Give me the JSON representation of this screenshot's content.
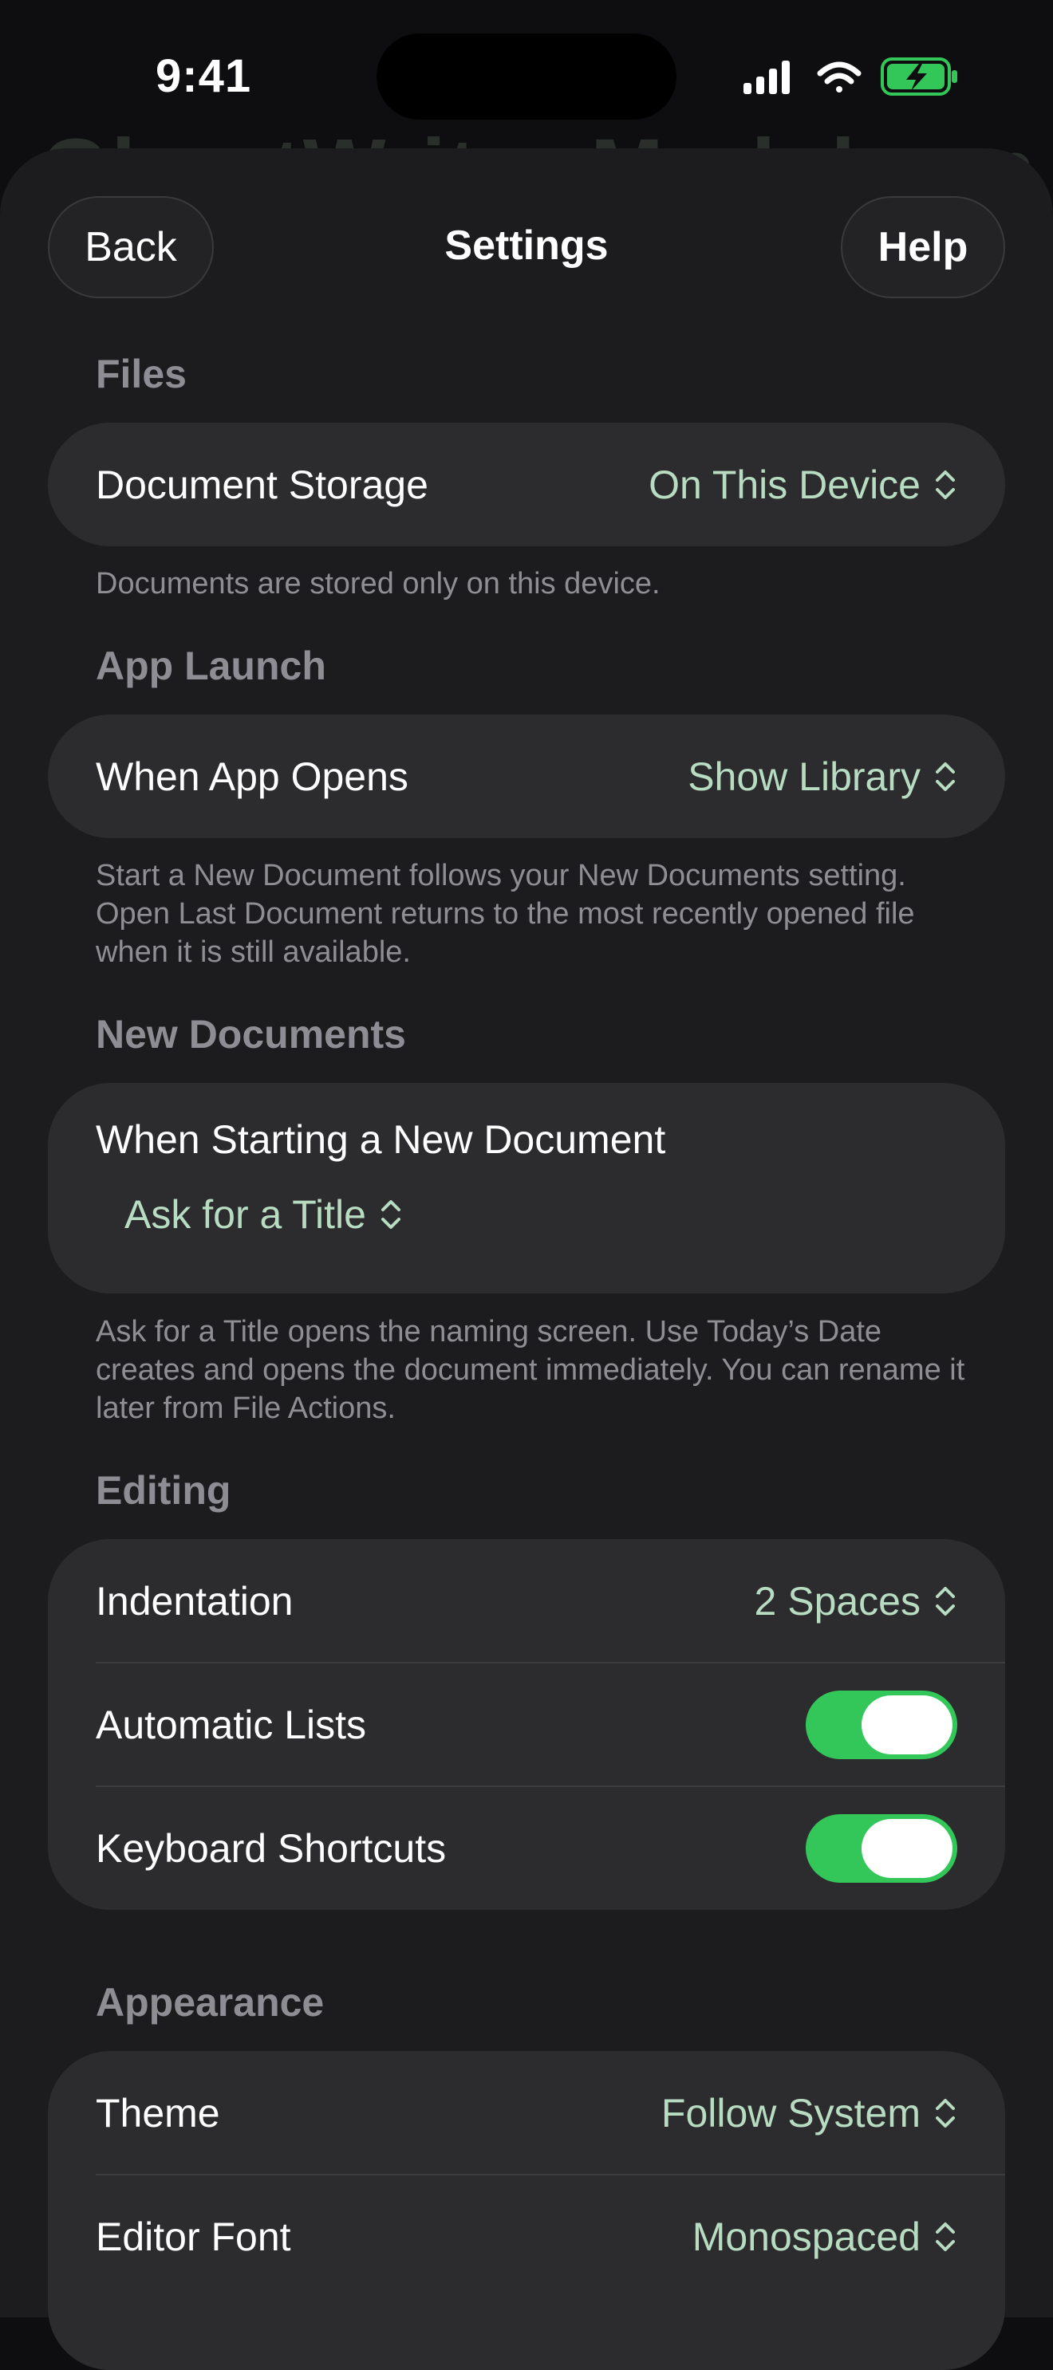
{
  "status": {
    "time": "9:41"
  },
  "background_title": "GhostWriter Markdown",
  "nav": {
    "back": "Back",
    "title": "Settings",
    "help": "Help"
  },
  "files": {
    "header": "Files",
    "storage_label": "Document Storage",
    "storage_value": "On This Device",
    "footnote": "Documents are stored only on this device."
  },
  "app_launch": {
    "header": "App Launch",
    "label": "When App Opens",
    "value": "Show Library",
    "footnote": "Start a New Document follows your New Documents setting. Open Last Document returns to the most recently opened file when it is still available."
  },
  "new_documents": {
    "header": "New Documents",
    "label": "When Starting a New Document",
    "value": "Ask for a Title",
    "footnote": "Ask for a Title opens the naming screen. Use Today’s Date creates and opens the document immediately. You can rename it later from File Actions."
  },
  "editing": {
    "header": "Editing",
    "indentation_label": "Indentation",
    "indentation_value": "2 Spaces",
    "auto_lists_label": "Automatic Lists",
    "auto_lists_on": true,
    "shortcuts_label": "Keyboard Shortcuts",
    "shortcuts_on": true
  },
  "appearance": {
    "header": "Appearance",
    "theme_label": "Theme",
    "theme_value": "Follow System",
    "font_label": "Editor Font",
    "font_value": "Monospaced"
  },
  "colors": {
    "accent_value": "#b7dcc1",
    "toggle_on": "#33c759",
    "battery": "#33c759"
  }
}
